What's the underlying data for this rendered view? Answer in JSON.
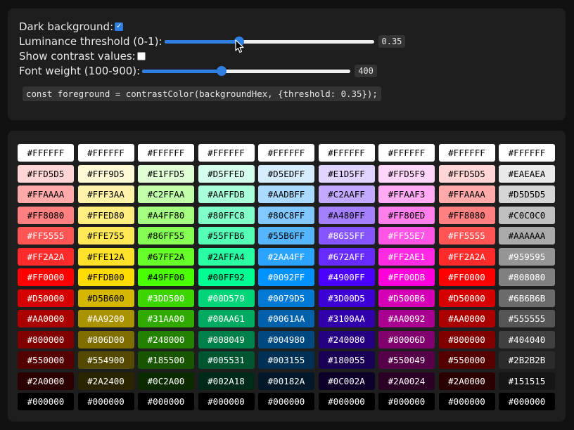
{
  "controls": {
    "dark_background": {
      "label": "Dark background:",
      "checked": true
    },
    "threshold": {
      "label": "Luminance threshold (0-1):",
      "value": "0.35",
      "fraction": 0.35
    },
    "show_contrast": {
      "label": "Show contrast values:",
      "checked": false
    },
    "font_weight": {
      "label": "Font weight (100-900):",
      "value": "400",
      "fraction": 0.375
    },
    "code": "const foreground = contrastColor(backgroundHex, {threshold: 0.35});"
  },
  "swatches": [
    [
      "#FFFFFF",
      "#FFFFFF",
      "#FFFFFF",
      "#FFFFFF",
      "#FFFFFF",
      "#FFFFFF",
      "#FFFFFF",
      "#FFFFFF",
      "#FFFFFF"
    ],
    [
      "#FFD5D5",
      "#FFF9D5",
      "#E1FFD5",
      "#D5FFED",
      "#D5EDFF",
      "#E1D5FF",
      "#FFD5F9",
      "#FFD5D5",
      "#EAEAEA"
    ],
    [
      "#FFAAAA",
      "#FFF3AA",
      "#C2FFAA",
      "#AAFFDB",
      "#AADBFF",
      "#C2AAFF",
      "#FFAAF3",
      "#FFAAAA",
      "#D5D5D5"
    ],
    [
      "#FF8080",
      "#FFED80",
      "#A4FF80",
      "#80FFC8",
      "#80C8FF",
      "#A480FF",
      "#FF80ED",
      "#FF8080",
      "#C0C0C0"
    ],
    [
      "#FF5555",
      "#FFE755",
      "#86FF55",
      "#55FFB6",
      "#55B6FF",
      "#8655FF",
      "#FF55E7",
      "#FF5555",
      "#AAAAAA"
    ],
    [
      "#FF2A2A",
      "#FFE12A",
      "#67FF2A",
      "#2AFFA4",
      "#2AA4FF",
      "#672AFF",
      "#FF2AE1",
      "#FF2A2A",
      "#959595"
    ],
    [
      "#FF0000",
      "#FFDB00",
      "#49FF00",
      "#00FF92",
      "#0092FF",
      "#4900FF",
      "#FF00DB",
      "#FF0000",
      "#808080"
    ],
    [
      "#D50000",
      "#D5B600",
      "#3DD500",
      "#00D579",
      "#0079D5",
      "#3D00D5",
      "#D500B6",
      "#D50000",
      "#6B6B6B"
    ],
    [
      "#AA0000",
      "#AA9200",
      "#31AA00",
      "#00AA61",
      "#0061AA",
      "#3100AA",
      "#AA0092",
      "#AA0000",
      "#555555"
    ],
    [
      "#800000",
      "#806D00",
      "#248000",
      "#008049",
      "#004980",
      "#240080",
      "#80006D",
      "#800000",
      "#404040"
    ],
    [
      "#550000",
      "#554900",
      "#185500",
      "#005531",
      "#003155",
      "#180055",
      "#550049",
      "#550000",
      "#2B2B2B"
    ],
    [
      "#2A0000",
      "#2A2400",
      "#0C2A00",
      "#002A18",
      "#00182A",
      "#0C002A",
      "#2A0024",
      "#2A0000",
      "#151515"
    ],
    [
      "#000000",
      "#000000",
      "#000000",
      "#000000",
      "#000000",
      "#000000",
      "#000000",
      "#000000",
      "#000000"
    ]
  ],
  "icons": {
    "cursor": "mouse-pointer-icon",
    "checkbox_checked": "checkmark-icon"
  }
}
